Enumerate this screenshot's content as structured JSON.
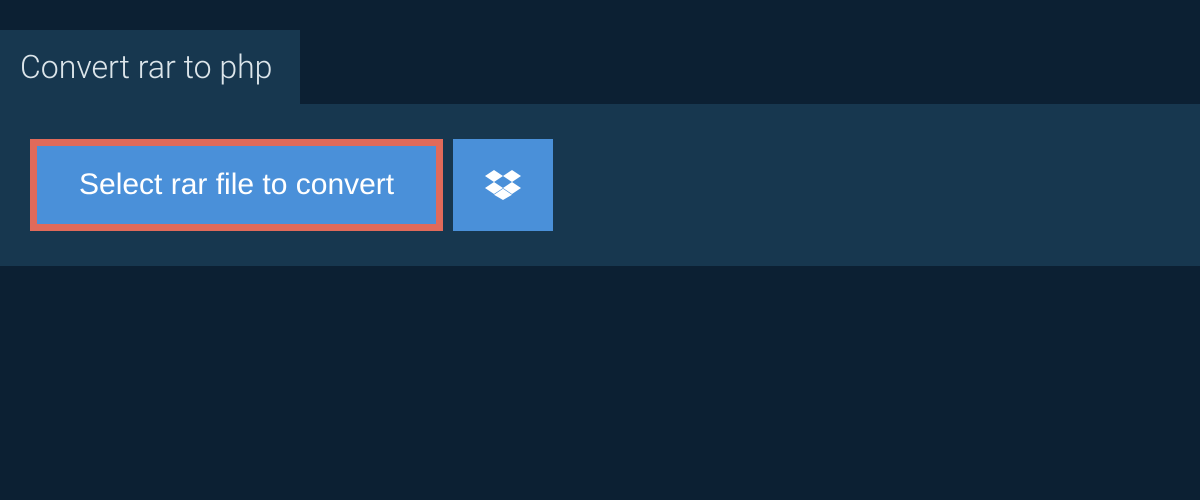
{
  "tab": {
    "title": "Convert rar to php"
  },
  "buttons": {
    "select_file_label": "Select rar file to convert"
  },
  "colors": {
    "page_bg": "#0c2033",
    "panel_bg": "#17374f",
    "button_bg": "#4a90d9",
    "button_highlight_border": "#e06a5a",
    "text_light": "#dce5ea",
    "text_white": "#ffffff"
  }
}
